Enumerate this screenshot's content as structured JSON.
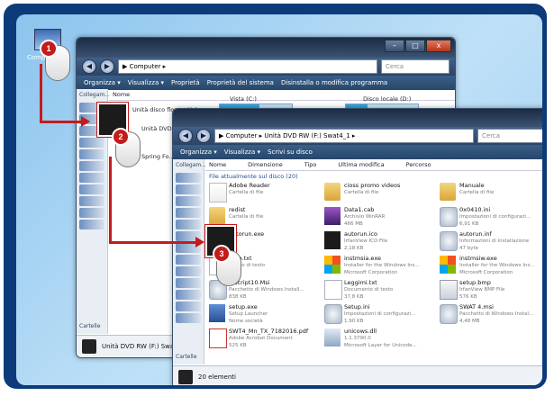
{
  "desktop": {
    "icon_label": "Computer"
  },
  "win1": {
    "address": "▶ Computer ▸",
    "search_placeholder": "Cerca",
    "toolbar": [
      "Organizza ▾",
      "Visualizza ▾",
      "Proprietà",
      "Proprietà del sistema",
      "Disinstalla o modifica programma"
    ],
    "column_header": "Nome",
    "drives": [
      {
        "name": "Unità disco floppy (A:)"
      },
      {
        "name": "Vista (C:)",
        "fill": 0.55
      },
      {
        "name": "Disco locale (D:)",
        "fill": 0.3
      },
      {
        "name": "Unità DVD RW"
      },
      {
        "name": "Spring Fo..."
      }
    ],
    "sidebar_label": "Collegam...",
    "folders_label": "Cartelle",
    "status": "Unità DVD RW (F:) Swat4"
  },
  "win2": {
    "address": "▶ Computer ▸ Unità DVD RW (F:) Swat4_1 ▸",
    "search_placeholder": "Cerca",
    "toolbar": [
      "Organizza ▾",
      "Visualizza ▾",
      "Scrivi su disco"
    ],
    "columns": [
      "Nome",
      "Dimensione",
      "Tipo",
      "Ultima modifica",
      "Percorso"
    ],
    "group_label": "File attualmente sul disco (20)",
    "sidebar_label": "Collegam...",
    "folders_label": "Cartelle",
    "files": [
      {
        "name": "Adobe Reader",
        "sub1": "Cartella di file",
        "sub2": "",
        "icon": "adobe-icon"
      },
      {
        "name": "cioss promo videos",
        "sub1": "Cartella di file",
        "sub2": "",
        "icon": "folder-icon"
      },
      {
        "name": "Manuale",
        "sub1": "Cartella di file",
        "sub2": "",
        "icon": "folder-icon"
      },
      {
        "name": "redist",
        "sub1": "Cartella di file",
        "sub2": "",
        "icon": "folder-icon"
      },
      {
        "name": "Data1.cab",
        "sub1": "Archivio WinRAR",
        "sub2": "466 MB",
        "icon": "rar-icon"
      },
      {
        "name": "0x0410.ini",
        "sub1": "Impostazioni di configurazi...",
        "sub2": "6,91 KB",
        "icon": "gear-icon"
      },
      {
        "name": "autorun.exe",
        "sub1": "",
        "sub2": "",
        "icon": "dark-icon"
      },
      {
        "name": "autorun.ico",
        "sub1": "IrfanView ICO File",
        "sub2": "2,18 KB",
        "icon": "dark-icon"
      },
      {
        "name": "autorun.inf",
        "sub1": "Informazioni di installazione",
        "sub2": "47 byte",
        "icon": "gear-icon"
      },
      {
        "name": "...rio.txt",
        "sub1": "...ento di testo",
        "sub2": "",
        "icon": "doc-icon"
      },
      {
        "name": "instmsia.exe",
        "sub1": "Installer for the Windows Ins...",
        "sub2": "Microsoft Corporation",
        "icon": "win-icon"
      },
      {
        "name": "instmsiw.exe",
        "sub1": "Installer for the Windows Ins...",
        "sub2": "Microsoft Corporation",
        "icon": "win-icon"
      },
      {
        "name": "...script10.Msi",
        "sub1": "Pacchetto di Windows Install...",
        "sub2": "838 KB",
        "icon": "gear-icon"
      },
      {
        "name": "Leggimi.txt",
        "sub1": "Documento di testo",
        "sub2": "37,8 KB",
        "icon": "doc-icon"
      },
      {
        "name": "setup.bmp",
        "sub1": "IrfanView BMP File",
        "sub2": "576 KB",
        "icon": "bmp-icon"
      },
      {
        "name": "setup.exe",
        "sub1": "Setup Launcher",
        "sub2": "Nome società",
        "icon": "blue-icon"
      },
      {
        "name": "Setup.ini",
        "sub1": "Impostazioni di configurazi...",
        "sub2": "1,90 KB",
        "icon": "gear-icon"
      },
      {
        "name": "SWAT 4.msi",
        "sub1": "Pacchetto di Windows Instal...",
        "sub2": "4,48 MB",
        "icon": "gear-icon"
      },
      {
        "name": "SWT4_Mn_TX_7182016.pdf",
        "sub1": "Adobe Acrobat Document",
        "sub2": "525 KB",
        "icon": "pdf-icon"
      },
      {
        "name": "unicows.dll",
        "sub1": "1.1.3790.0",
        "sub2": "Microsoft Layer for Unicode...",
        "icon": "dll-icon"
      }
    ],
    "status": "20 elementi"
  },
  "badges": [
    "1",
    "2",
    "3"
  ],
  "colors": {
    "accent": "#c41b1b",
    "frame": "#0d3b7a"
  }
}
